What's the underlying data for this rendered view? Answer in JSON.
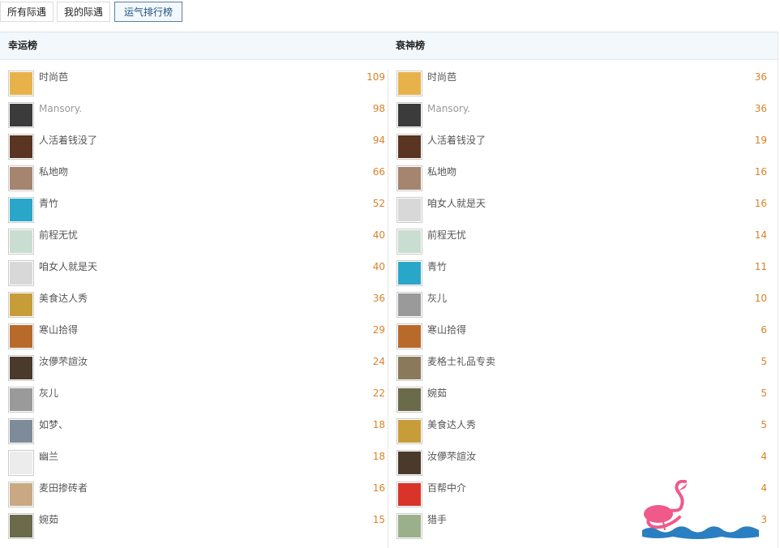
{
  "tabs": [
    {
      "label": "所有际遇",
      "active": false
    },
    {
      "label": "我的际遇",
      "active": false
    },
    {
      "label": "运气排行榜",
      "active": true
    }
  ],
  "lucky": {
    "title": "幸运榜",
    "rows": [
      {
        "name": "时尚芭",
        "score": "109",
        "avatar_color": "#e8b24a"
      },
      {
        "name": "Mansory.",
        "score": "98",
        "avatar_color": "#3b3b3b"
      },
      {
        "name": "人活着钱没了",
        "score": "94",
        "avatar_color": "#5a3522"
      },
      {
        "name": "私地吻",
        "score": "66",
        "avatar_color": "#a58470"
      },
      {
        "name": "青竹",
        "score": "52",
        "avatar_color": "#2aa6c8"
      },
      {
        "name": "前程无忧",
        "score": "40",
        "avatar_color": "#c9ded0"
      },
      {
        "name": "咱女人就是天",
        "score": "40",
        "avatar_color": "#d8d8d8"
      },
      {
        "name": "美食达人秀",
        "score": "36",
        "avatar_color": "#c79d3a"
      },
      {
        "name": "寒山拾得",
        "score": "29",
        "avatar_color": "#b86a2a"
      },
      {
        "name": "汝儚芣諠汝",
        "score": "24",
        "avatar_color": "#4a3a2a"
      },
      {
        "name": "灰儿",
        "score": "22",
        "avatar_color": "#9a9a9a"
      },
      {
        "name": "如梦、",
        "score": "18",
        "avatar_color": "#7e8c9a"
      },
      {
        "name": "幽兰",
        "score": "18",
        "avatar_color": "#ececec"
      },
      {
        "name": "麦田掺砖者",
        "score": "16",
        "avatar_color": "#c9a883"
      },
      {
        "name": "婉茹",
        "score": "15",
        "avatar_color": "#6b6a4a"
      }
    ]
  },
  "unlucky": {
    "title": "衰神榜",
    "rows": [
      {
        "name": "时尚芭",
        "score": "36",
        "avatar_color": "#e8b24a"
      },
      {
        "name": "Mansory.",
        "score": "36",
        "avatar_color": "#3b3b3b"
      },
      {
        "name": "人活着钱没了",
        "score": "19",
        "avatar_color": "#5a3522"
      },
      {
        "name": "私地吻",
        "score": "16",
        "avatar_color": "#a58470"
      },
      {
        "name": "咱女人就是天",
        "score": "16",
        "avatar_color": "#d8d8d8"
      },
      {
        "name": "前程无忧",
        "score": "14",
        "avatar_color": "#c9ded0"
      },
      {
        "name": "青竹",
        "score": "11",
        "avatar_color": "#2aa6c8"
      },
      {
        "name": "灰儿",
        "score": "10",
        "avatar_color": "#9a9a9a"
      },
      {
        "name": "寒山拾得",
        "score": "6",
        "avatar_color": "#b86a2a"
      },
      {
        "name": "麦格士礼品专卖",
        "score": "5",
        "avatar_color": "#8a7a5a"
      },
      {
        "name": "婉茹",
        "score": "5",
        "avatar_color": "#6b6a4a"
      },
      {
        "name": "美食达人秀",
        "score": "5",
        "avatar_color": "#c79d3a"
      },
      {
        "name": "汝儚芣諠汝",
        "score": "4",
        "avatar_color": "#4a3a2a"
      },
      {
        "name": "百帮中介",
        "score": "4",
        "avatar_color": "#d8342a"
      },
      {
        "name": "猎手",
        "score": "3",
        "avatar_color": "#9bb08a"
      }
    ]
  },
  "colors": {
    "score": "#d9822b",
    "active_tab": "#1f4f82",
    "header_bg": "#f2f8fc"
  }
}
